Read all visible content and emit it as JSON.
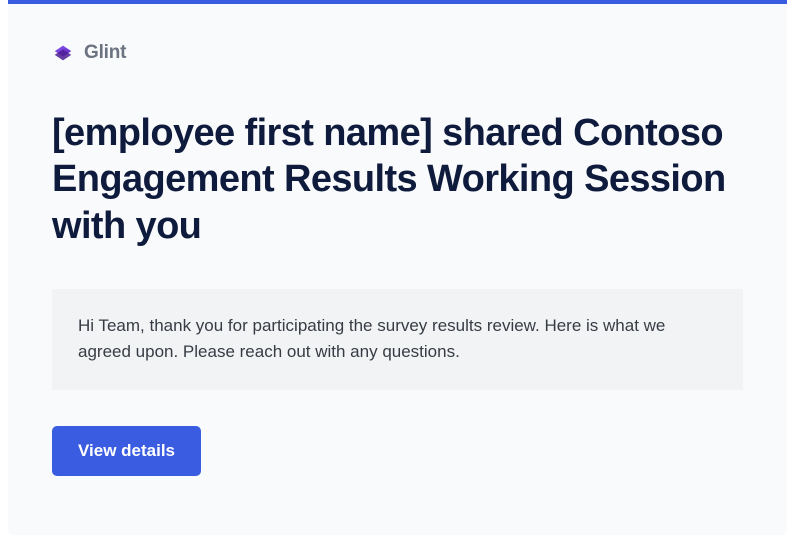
{
  "brand": {
    "name": "Glint",
    "icon_name": "glint-logo-icon"
  },
  "headline": "[employee first name] shared Contoso Engagement Results Working Session with you",
  "message": "Hi Team, thank you for participating the survey results review. Here is what we agreed upon. Please reach out with any questions.",
  "cta": {
    "label": "View details"
  },
  "colors": {
    "accent": "#3a5ce0",
    "heading": "#0e1b3d",
    "body": "#373c44",
    "panel_bg": "#f9fafb",
    "message_bg": "#f2f3f5"
  }
}
